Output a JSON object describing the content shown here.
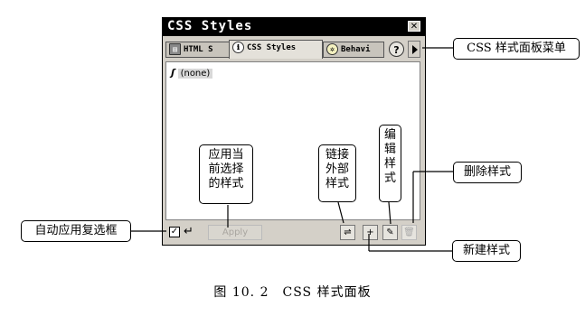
{
  "panel": {
    "title": "CSS Styles",
    "close_glyph": "✕",
    "tabs": [
      {
        "label": "HTML S",
        "icon": "html-styles-icon"
      },
      {
        "label": "CSS Styles",
        "icon": "css-styles-icon"
      },
      {
        "label": "Behavi",
        "icon": "behaviors-icon"
      }
    ],
    "help_glyph": "?",
    "style_list": [
      {
        "name": "(none)",
        "icon": "style-s-icon"
      }
    ],
    "apply_label": "Apply",
    "auto_apply_checked": true
  },
  "annotations": {
    "menu": "CSS 样式面板菜单",
    "apply": "应用当前选择的样式",
    "link": "链接外部样式",
    "edit": "编辑样式",
    "delete": "删除样式",
    "auto_apply": "自动应用复选框",
    "new": "新建样式"
  },
  "caption": "图 10. 2　CSS 样式面板"
}
